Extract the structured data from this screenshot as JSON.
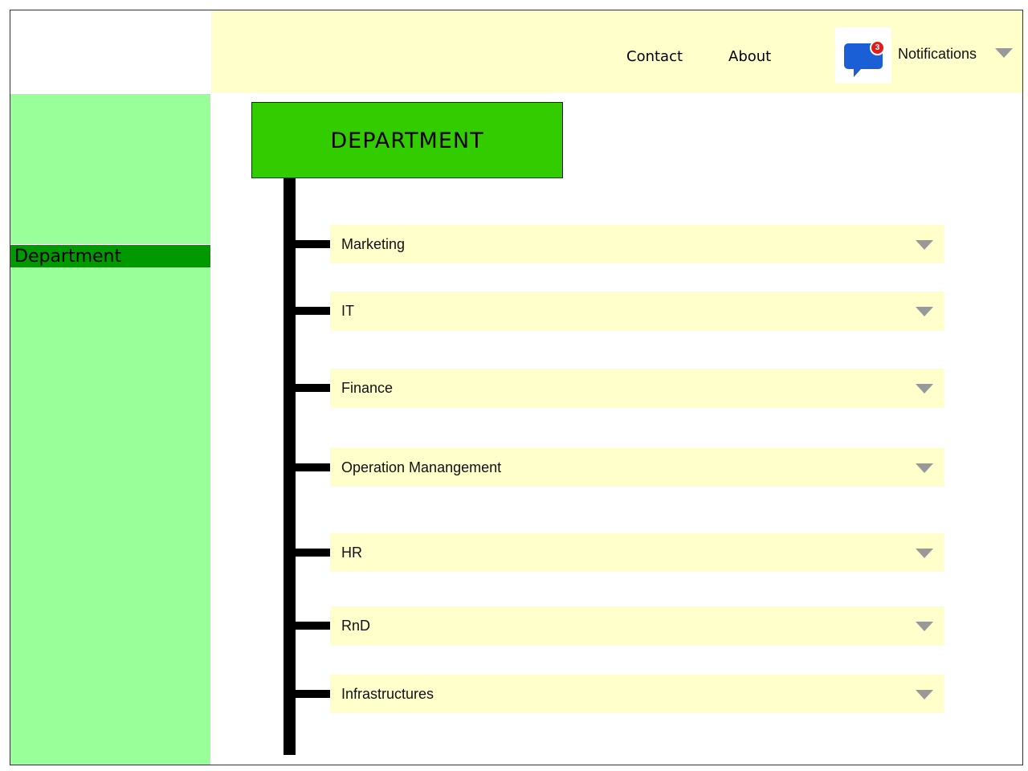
{
  "header": {
    "nav": {
      "contact": "Contact",
      "about": "About"
    },
    "notifications": {
      "label": "Notifications",
      "count": "3"
    }
  },
  "sidebar": {
    "items": [
      {
        "label": "Department"
      }
    ]
  },
  "main": {
    "title": "DEPARTMENT",
    "departments": [
      "Marketing",
      "IT",
      "Finance",
      "Operation Manangement",
      "HR",
      "RnD",
      "Infrastructures"
    ]
  },
  "colors": {
    "header_bg": "#ffffcc",
    "sidebar_bg": "#99ff99",
    "sidebar_active": "#009900",
    "title_box": "#33cc00",
    "row_bg": "#ffffcc",
    "badge": "#e21b1b",
    "chat_icon": "#1a5fd6"
  },
  "icons": {
    "notifications": "chat-bubble-icon",
    "dropdown": "caret-down-icon"
  }
}
